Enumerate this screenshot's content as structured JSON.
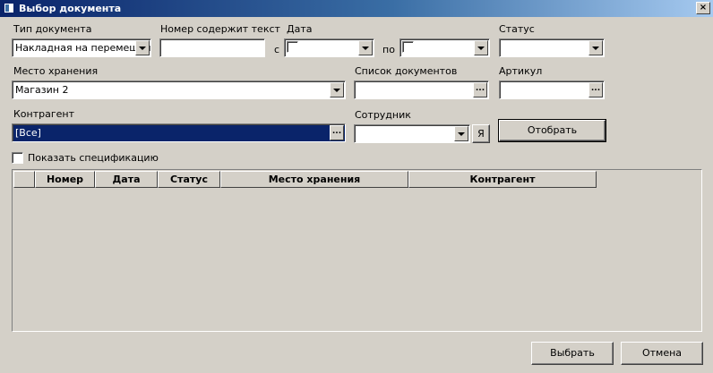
{
  "window": {
    "title": "Выбор документа",
    "close_label": "×"
  },
  "filters": {
    "doc_type": {
      "label": "Тип документа",
      "value": "Накладная на перемещен"
    },
    "number_contains": {
      "label": "Номер содержит текст",
      "value": ""
    },
    "date": {
      "label": "Дата",
      "from_label": "с",
      "to_label": "по",
      "from_value": "",
      "to_value": ""
    },
    "status": {
      "label": "Статус",
      "value": ""
    },
    "storage": {
      "label": "Место хранения",
      "value": "Магазин 2"
    },
    "doc_list": {
      "label": "Список документов",
      "value": ""
    },
    "article": {
      "label": "Артикул",
      "value": ""
    },
    "counterparty": {
      "label": "Контрагент",
      "value": "[Все]"
    },
    "employee": {
      "label": "Сотрудник",
      "value": "",
      "me_label": "Я"
    },
    "show_spec": {
      "label": "Показать спецификацию",
      "checked": false
    }
  },
  "buttons": {
    "filter": "Отобрать",
    "select": "Выбрать",
    "cancel": "Отмена",
    "ellipsis": "..."
  },
  "table": {
    "columns": [
      "",
      "Номер",
      "Дата",
      "Статус",
      "Место хранения",
      "Контрагент"
    ],
    "rows": []
  }
}
